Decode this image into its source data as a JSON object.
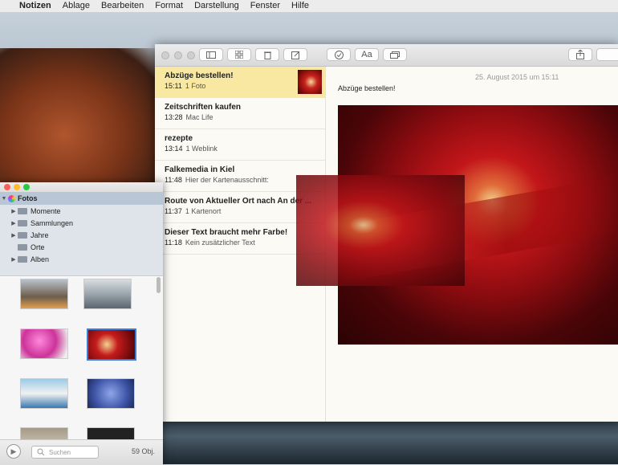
{
  "menubar": {
    "apple": "",
    "app": "Notizen",
    "items": [
      "Ablage",
      "Bearbeiten",
      "Format",
      "Darstellung",
      "Fenster",
      "Hilfe"
    ]
  },
  "toolbar": {
    "font_label": "Aa"
  },
  "notes": [
    {
      "title": "Abzüge bestellen!",
      "time": "15:11",
      "detail": "1 Foto",
      "selected": true
    },
    {
      "title": "Zeitschriften kaufen",
      "time": "13:28",
      "detail": "Mac Life"
    },
    {
      "title": "rezepte",
      "time": "13:14",
      "detail": "1 Weblink"
    },
    {
      "title": "Falkemedia in Kiel",
      "time": "11:48",
      "detail": "Hier der Kartenausschnitt:"
    },
    {
      "title": "Route von Aktueller Ort nach An der ...",
      "time": "11:37",
      "detail": "1 Kartenort"
    },
    {
      "title": "Dieser Text braucht mehr Farbe!",
      "time": "11:18",
      "detail": "Kein zusätzlicher Text"
    }
  ],
  "editor": {
    "date": "25. August 2015 um 15:11",
    "text": "Abzüge bestellen!"
  },
  "photos": {
    "root": "Fotos",
    "items": [
      "Momente",
      "Sammlungen",
      "Jahre",
      "Orte",
      "Alben"
    ],
    "search_placeholder": "Suchen",
    "count": "59 Obj."
  },
  "colors": {
    "selected_note": "#f8e8a2",
    "accent": "#3b7bdc"
  }
}
